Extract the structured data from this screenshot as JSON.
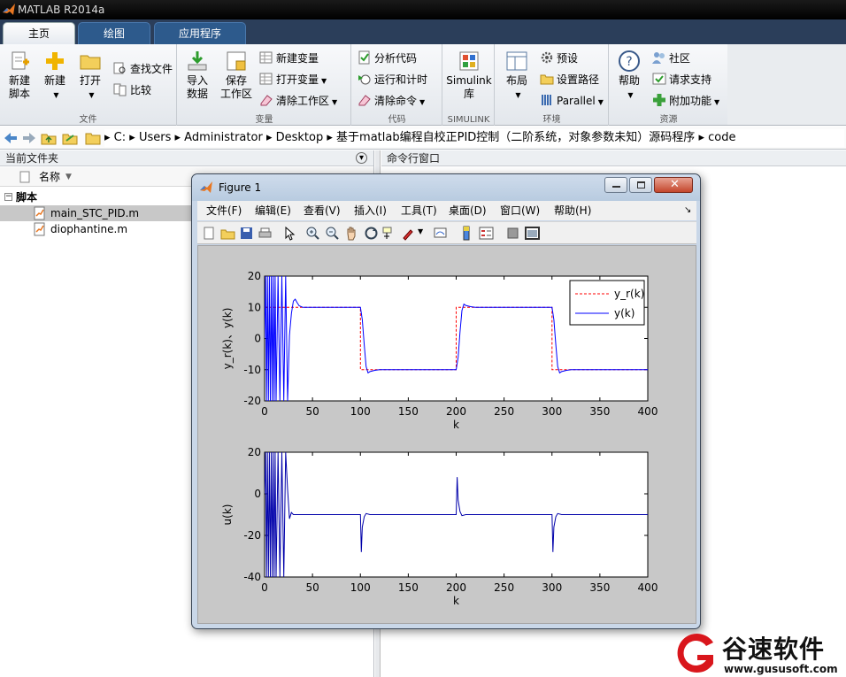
{
  "window": {
    "title": "MATLAB R2014a"
  },
  "tabs": [
    {
      "label": "主页"
    },
    {
      "label": "绘图"
    },
    {
      "label": "应用程序"
    }
  ],
  "ribbon": {
    "file": {
      "label": "文件",
      "new_script": "新建\n脚本",
      "new": "新建",
      "open": "打开",
      "find_files": "查找文件",
      "compare": "比较"
    },
    "variable": {
      "label": "变量",
      "import": "导入\n数据",
      "save_ws": "保存\n工作区",
      "new_var": "新建变量",
      "open_var": "打开变量",
      "clear_ws": "清除工作区"
    },
    "code": {
      "label": "代码",
      "analyze": "分析代码",
      "run_time": "运行和计时",
      "clear_cmd": "清除命令"
    },
    "simulink": {
      "label": "SIMULINK",
      "lib": "Simulink\n库"
    },
    "env": {
      "label": "环境",
      "layout": "布局",
      "prefs": "预设",
      "set_path": "设置路径",
      "parallel": "Parallel"
    },
    "resources": {
      "label": "资源",
      "help": "帮助",
      "community": "社区",
      "support": "请求支持",
      "addons": "附加功能"
    }
  },
  "address": {
    "parts": [
      "C:",
      "Users",
      "Administrator",
      "Desktop",
      "基于matlab编程自校正PID控制（二阶系统，对象参数未知）源码程序",
      "code"
    ]
  },
  "left_panel": {
    "title": "当前文件夹",
    "col_name": "名称",
    "group": "脚本",
    "files": [
      "main_STC_PID.m",
      "diophantine.m"
    ]
  },
  "right_panel": {
    "title": "命令行窗口"
  },
  "figure": {
    "title": "Figure 1",
    "menu": [
      "文件(F)",
      "编辑(E)",
      "查看(V)",
      "插入(I)",
      "工具(T)",
      "桌面(D)",
      "窗口(W)",
      "帮助(H)"
    ]
  },
  "chart_data": [
    {
      "type": "line",
      "xlabel": "k",
      "ylabel": "y_r(k)、y(k)",
      "xlim": [
        0,
        400
      ],
      "ylim": [
        -20,
        20
      ],
      "xticks": [
        0,
        50,
        100,
        150,
        200,
        250,
        300,
        350,
        400
      ],
      "yticks": [
        -20,
        -10,
        0,
        10,
        20
      ],
      "legend": {
        "placement": "top-right",
        "entries": [
          "y_r(k)",
          "y(k)"
        ]
      },
      "series": [
        {
          "name": "y_r(k)",
          "color": "#ff0000",
          "style": "dashed",
          "x": [
            0,
            100,
            100,
            200,
            200,
            300,
            300,
            400
          ],
          "y": [
            10,
            10,
            -10,
            -10,
            10,
            10,
            -10,
            -10
          ]
        },
        {
          "name": "y(k)",
          "color": "#0000ff",
          "style": "solid",
          "x": [
            0,
            1,
            2,
            3,
            4,
            5,
            6,
            7,
            8,
            9,
            10,
            11,
            12,
            14,
            16,
            18,
            20,
            22,
            24,
            26,
            28,
            30,
            32,
            34,
            36,
            40,
            50,
            100,
            102,
            104,
            106,
            108,
            110,
            115,
            120,
            200,
            202,
            204,
            206,
            208,
            210,
            215,
            220,
            300,
            302,
            304,
            306,
            308,
            310,
            315,
            320,
            400
          ],
          "y": [
            0,
            20,
            -20,
            20,
            -20,
            20,
            -20,
            20,
            -20,
            20,
            -20,
            20,
            -20,
            20,
            -20,
            20,
            -20,
            20,
            -20,
            1,
            8,
            12,
            12.6,
            11.5,
            10.5,
            10,
            10,
            10,
            6,
            -2,
            -9,
            -11,
            -10.6,
            -10.2,
            -10,
            -10,
            -6,
            2,
            9,
            11,
            10.6,
            10.2,
            10,
            10,
            6,
            -2,
            -9,
            -11,
            -10.6,
            -10.2,
            -10,
            -10
          ]
        }
      ]
    },
    {
      "type": "line",
      "xlabel": "k",
      "ylabel": "u(k)",
      "xlim": [
        0,
        400
      ],
      "ylim": [
        -40,
        20
      ],
      "xticks": [
        0,
        50,
        100,
        150,
        200,
        250,
        300,
        350,
        400
      ],
      "yticks": [
        -40,
        -20,
        0,
        20
      ],
      "series": [
        {
          "name": "u(k)",
          "color": "#0000aa",
          "style": "solid",
          "x": [
            0,
            1,
            2,
            3,
            4,
            5,
            6,
            7,
            8,
            9,
            10,
            11,
            12,
            14,
            16,
            18,
            20,
            22,
            24,
            26,
            28,
            30,
            34,
            40,
            100,
            101,
            102,
            104,
            106,
            110,
            120,
            200,
            201,
            202,
            204,
            206,
            210,
            220,
            300,
            301,
            302,
            304,
            306,
            310,
            320,
            400
          ],
          "y": [
            0,
            20,
            -40,
            20,
            -40,
            20,
            -40,
            20,
            -40,
            20,
            -40,
            20,
            -40,
            20,
            -40,
            20,
            -40,
            20,
            2,
            -12,
            -9,
            -10,
            -10,
            -10,
            -10,
            -28,
            -16,
            -11,
            -9.5,
            -10,
            -10,
            -10,
            8,
            -3,
            -8.5,
            -10.5,
            -10,
            -10,
            -10,
            -28,
            -16,
            -11,
            -9.5,
            -10,
            -10,
            -10
          ]
        }
      ]
    }
  ],
  "brand": {
    "name": "谷速软件",
    "url": "www.gususoft.com"
  },
  "colors": {
    "tabbar": "#2b3e5a",
    "titlebar": "#000000",
    "figure_frame": "#c9d7e8"
  }
}
